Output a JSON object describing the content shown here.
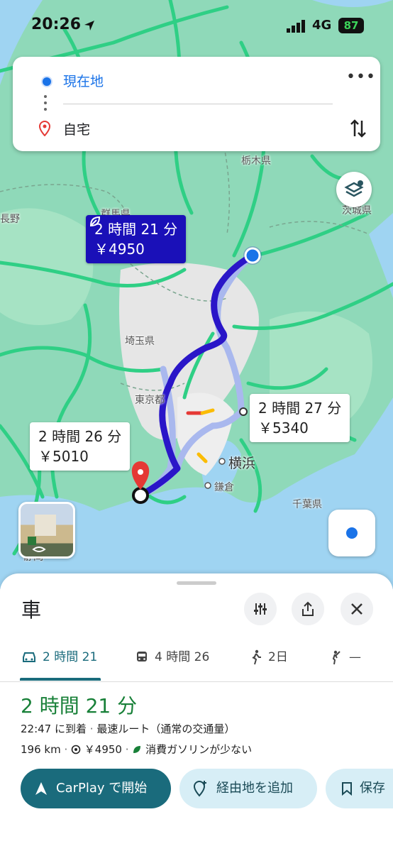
{
  "status_bar": {
    "time": "20:26",
    "network": "4G",
    "battery": "87"
  },
  "search": {
    "origin": "現在地",
    "destination": "自宅"
  },
  "map": {
    "labels": {
      "tochigi": "栃木県",
      "gunma": "群馬県",
      "nagano": "長野",
      "ibaraki": "茨城県",
      "saitama": "埼玉県",
      "tokyo": "東京都",
      "yokohama": "横浜",
      "kamakura": "鎌倉",
      "chiba": "千葉県",
      "shizuoka": "静岡"
    },
    "routes": [
      {
        "time": "2 時間 21 分",
        "toll": "￥4950",
        "selected": true
      },
      {
        "time": "2 時間 27 分",
        "toll": "￥5340",
        "selected": false
      },
      {
        "time": "2 時間 26 分",
        "toll": "￥5010",
        "selected": false
      }
    ]
  },
  "sheet": {
    "title": "車",
    "tabs": [
      {
        "label": "2 時間 21",
        "icon": "car-icon",
        "active": true
      },
      {
        "label": "4 時間 26",
        "icon": "train-icon",
        "active": false
      },
      {
        "label": "2日",
        "icon": "walk-icon",
        "active": false
      },
      {
        "label": "—",
        "icon": "ride-hail-icon",
        "active": false
      }
    ],
    "duration": "2 時間 21 分",
    "arrival": "22:47 に到着",
    "dot": " · ",
    "route_desc": "最速ルート（通常の交通量）",
    "distance": "196 km",
    "toll": "￥4950",
    "eco": "消費ガソリンが少ない",
    "buttons": {
      "start": "CarPlay で開始",
      "add_stop": "経由地を追加",
      "save": "保存"
    }
  },
  "colors": {
    "route_selected": "#2a16c8",
    "route_alt": "#a9b8ee",
    "accent": "#1a6b7c",
    "duration_green": "#188038",
    "my_location": "#1a73e8"
  }
}
